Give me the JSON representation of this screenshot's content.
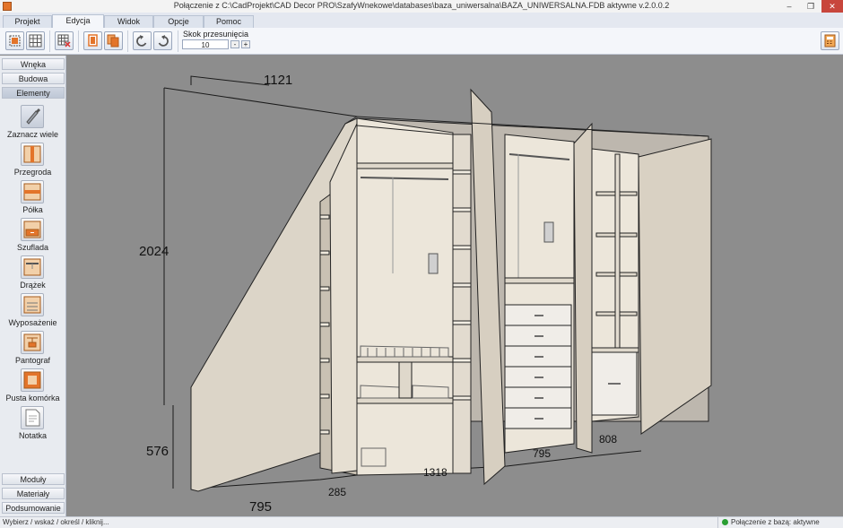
{
  "window": {
    "title": "Połączenie z C:\\CadProjekt\\CAD Decor PRO\\SzafyWnekowe\\databases\\baza_uniwersalna\\BAZA_UNIWERSALNA.FDB aktywne  v.2.0.0.2",
    "minimize": "–",
    "restore": "❐",
    "close": "✕"
  },
  "tabs": [
    "Projekt",
    "Edycja",
    "Widok",
    "Opcje",
    "Pomoc"
  ],
  "active_tab": "Edycja",
  "toolbar": {
    "step_label": "Skok przesunięcia",
    "step_value": "10",
    "step_minus": "-",
    "step_plus": "+"
  },
  "sidebar": {
    "top_buttons": [
      "Wnęka",
      "Budowa",
      "Elementy"
    ],
    "active_top": "Elementy",
    "tools": [
      "Zaznacz wiele",
      "Przegroda",
      "Półka",
      "Szuflada",
      "Drążek",
      "Wyposażenie",
      "Pantograf",
      "Pusta komórka",
      "Notatka"
    ],
    "bottom_buttons": [
      "Moduły",
      "Materiały",
      "Podsumowanie"
    ]
  },
  "dimensions": {
    "top_width": "1121",
    "height": "2024",
    "knee_height": "576",
    "bottom_left": "795",
    "bottom_285": "285",
    "bottom_1318": "1318",
    "bottom_795": "795",
    "bottom_808": "808"
  },
  "status": {
    "hint": "Wybierz / wskaż / określ / kliknij...",
    "connection": "Połączenie z bazą: aktywne"
  },
  "colors": {
    "accent": "#e3742a",
    "status_ok": "#2a9e33",
    "viewport_bg": "#8d8d8d",
    "board": "#d9d0c2"
  }
}
